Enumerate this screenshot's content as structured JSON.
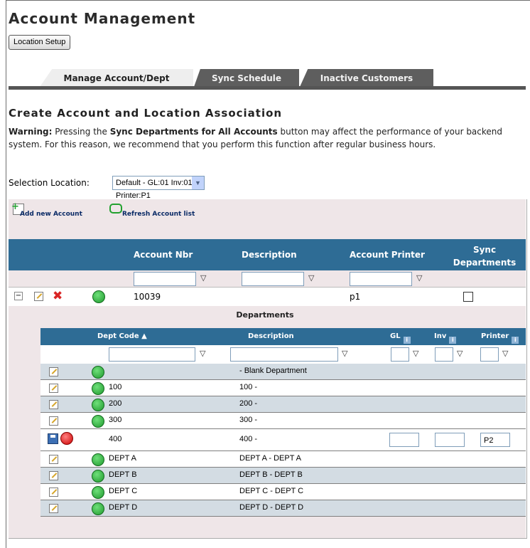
{
  "page": {
    "title": "Account Management",
    "location_setup_button": "Location Setup"
  },
  "tabs": [
    {
      "label": "Manage Account/Dept",
      "active": true
    },
    {
      "label": "Sync Schedule",
      "active": false
    },
    {
      "label": "Inactive Customers",
      "active": false
    }
  ],
  "section": {
    "heading": "Create Account and Location Association",
    "warning_label": "Warning:",
    "warning_text_1": " Pressing the ",
    "warning_bold": "Sync Departments for All Accounts",
    "warning_text_2": " button may affect the performance of your backend system. For this reason, we recommend that you perform this function after regular business hours.",
    "selection_label": "Selection Location:",
    "selection_value": "Default - GL:01 Inv:01 Printer:P1"
  },
  "toolbar": {
    "add_label": "Add new Account",
    "refresh_label": "Refresh Account list"
  },
  "accounts_header": {
    "account_nbr": "Account Nbr",
    "description": "Description",
    "account_printer": "Account Printer",
    "sync_departments": "Sync Departments"
  },
  "account_row": {
    "account_nbr": "10039",
    "description": "",
    "printer": "p1"
  },
  "departments": {
    "caption": "Departments",
    "header": {
      "dept_code": "Dept Code",
      "description": "Description",
      "gl": "GL",
      "inv": "Inv",
      "printer": "Printer"
    },
    "rows": [
      {
        "code": "",
        "description": "- Blank Department"
      },
      {
        "code": "100",
        "description": "100 -"
      },
      {
        "code": "200",
        "description": "200 -"
      },
      {
        "code": "300",
        "description": "300 -"
      },
      {
        "code": "400",
        "description": "400 -",
        "editing": true,
        "printer_value": "P2"
      },
      {
        "code": "DEPT A",
        "description": "DEPT A - DEPT A"
      },
      {
        "code": "DEPT B",
        "description": "DEPT B - DEPT B"
      },
      {
        "code": "DEPT C",
        "description": "DEPT C - DEPT C"
      },
      {
        "code": "DEPT D",
        "description": "DEPT D - DEPT D"
      }
    ]
  },
  "colors": {
    "header_blue": "#2e6c95",
    "row_alt": "#d3dce3",
    "panel_pink": "#efe6e8"
  }
}
